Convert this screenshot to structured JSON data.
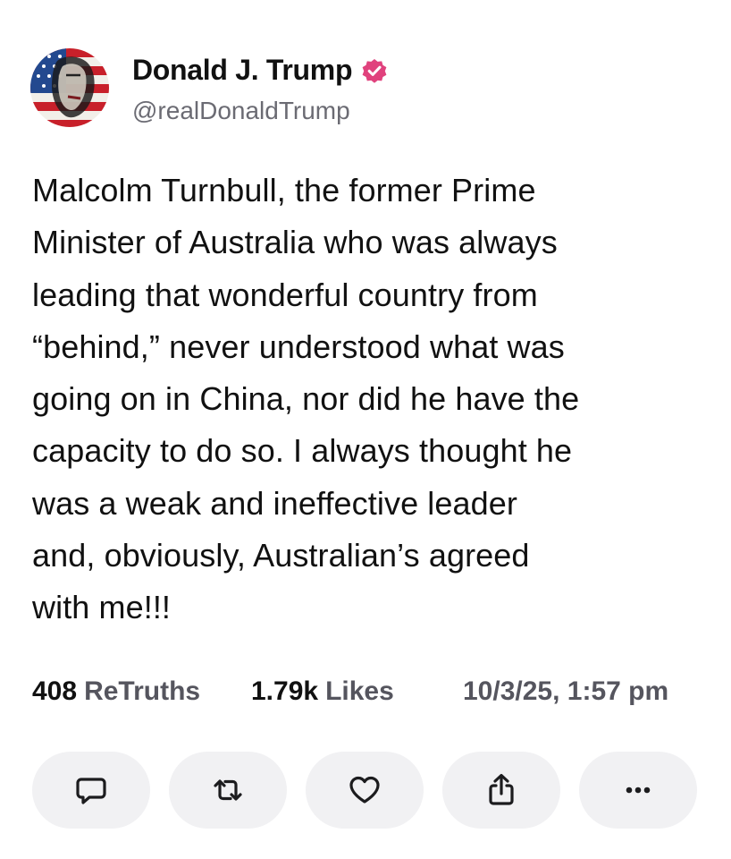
{
  "author": {
    "display_name": "Donald J. Trump",
    "handle": "@realDonaldTrump",
    "verified_color": "#e0427d"
  },
  "post": {
    "text": "Malcolm Turnbull, the former Prime\nMinister of Australia who was always\nleading that wonderful country from\n“behind,” never understood what was\ngoing on in China, nor did he have the\ncapacity to do so. I always thought he\nwas a weak and ineffective leader\nand, obviously, Australian’s agreed\nwith me!!!"
  },
  "stats": {
    "retruths_count": "408",
    "retruths_label": "ReTruths",
    "likes_count": "1.79k",
    "likes_label": "Likes",
    "timestamp": "10/3/25, 1:57 pm"
  },
  "actions": {
    "reply_icon": "reply-icon",
    "retruth_icon": "retruth-icon",
    "like_icon": "heart-icon",
    "share_icon": "share-icon",
    "more_icon": "more-icon"
  },
  "colors": {
    "text": "#111111",
    "muted": "#55555e",
    "button_bg": "#f1f1f3",
    "accent": "#e0427d"
  }
}
